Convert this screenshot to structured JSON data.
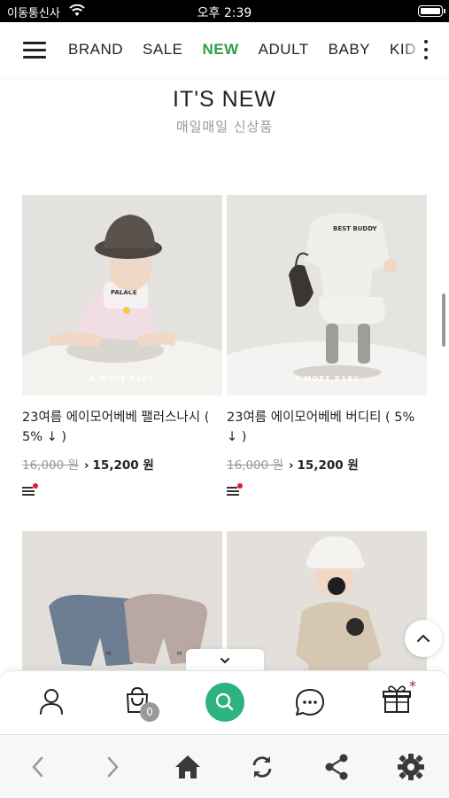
{
  "status": {
    "carrier": "이동통신사",
    "time": "오후 2:39",
    "icons": [
      "wifi-icon",
      "battery-icon"
    ]
  },
  "nav": {
    "items": [
      {
        "label": "BRAND",
        "active": false
      },
      {
        "label": "SALE",
        "active": false
      },
      {
        "label": "NEW",
        "active": true
      },
      {
        "label": "ADULT",
        "active": false
      },
      {
        "label": "BABY",
        "active": false
      },
      {
        "label": "KIDS",
        "active": false
      }
    ],
    "accent": "#2aa14a"
  },
  "section": {
    "title": "IT'S NEW",
    "subtitle": "매일매일 신상품"
  },
  "products": [
    {
      "name": "23여름 에이모어베베 팰러스나시 ( 5% ↓ )",
      "orig_price": "16,000 원",
      "sale_price": "15,200 원",
      "watermark": "A MORE.BABY"
    },
    {
      "name": "23여름 에이모어베베 버디티 ( 5% ↓ )",
      "orig_price": "16,000 원",
      "sale_price": "15,200 원",
      "watermark": "A MORE.BABY"
    },
    {
      "name": "",
      "orig_price": "",
      "sale_price": "",
      "watermark": ""
    },
    {
      "name": "",
      "orig_price": "",
      "sale_price": "",
      "watermark": ""
    }
  ],
  "appbar": {
    "items": [
      "user-icon",
      "cart-icon",
      "search-icon",
      "chat-icon",
      "gift-icon"
    ],
    "cart_count": "0",
    "search_color": "#2db37e",
    "gift_mark": "*"
  },
  "browser": {
    "items": [
      "back-icon",
      "forward-icon",
      "home-icon",
      "refresh-icon",
      "share-icon",
      "settings-icon"
    ]
  }
}
